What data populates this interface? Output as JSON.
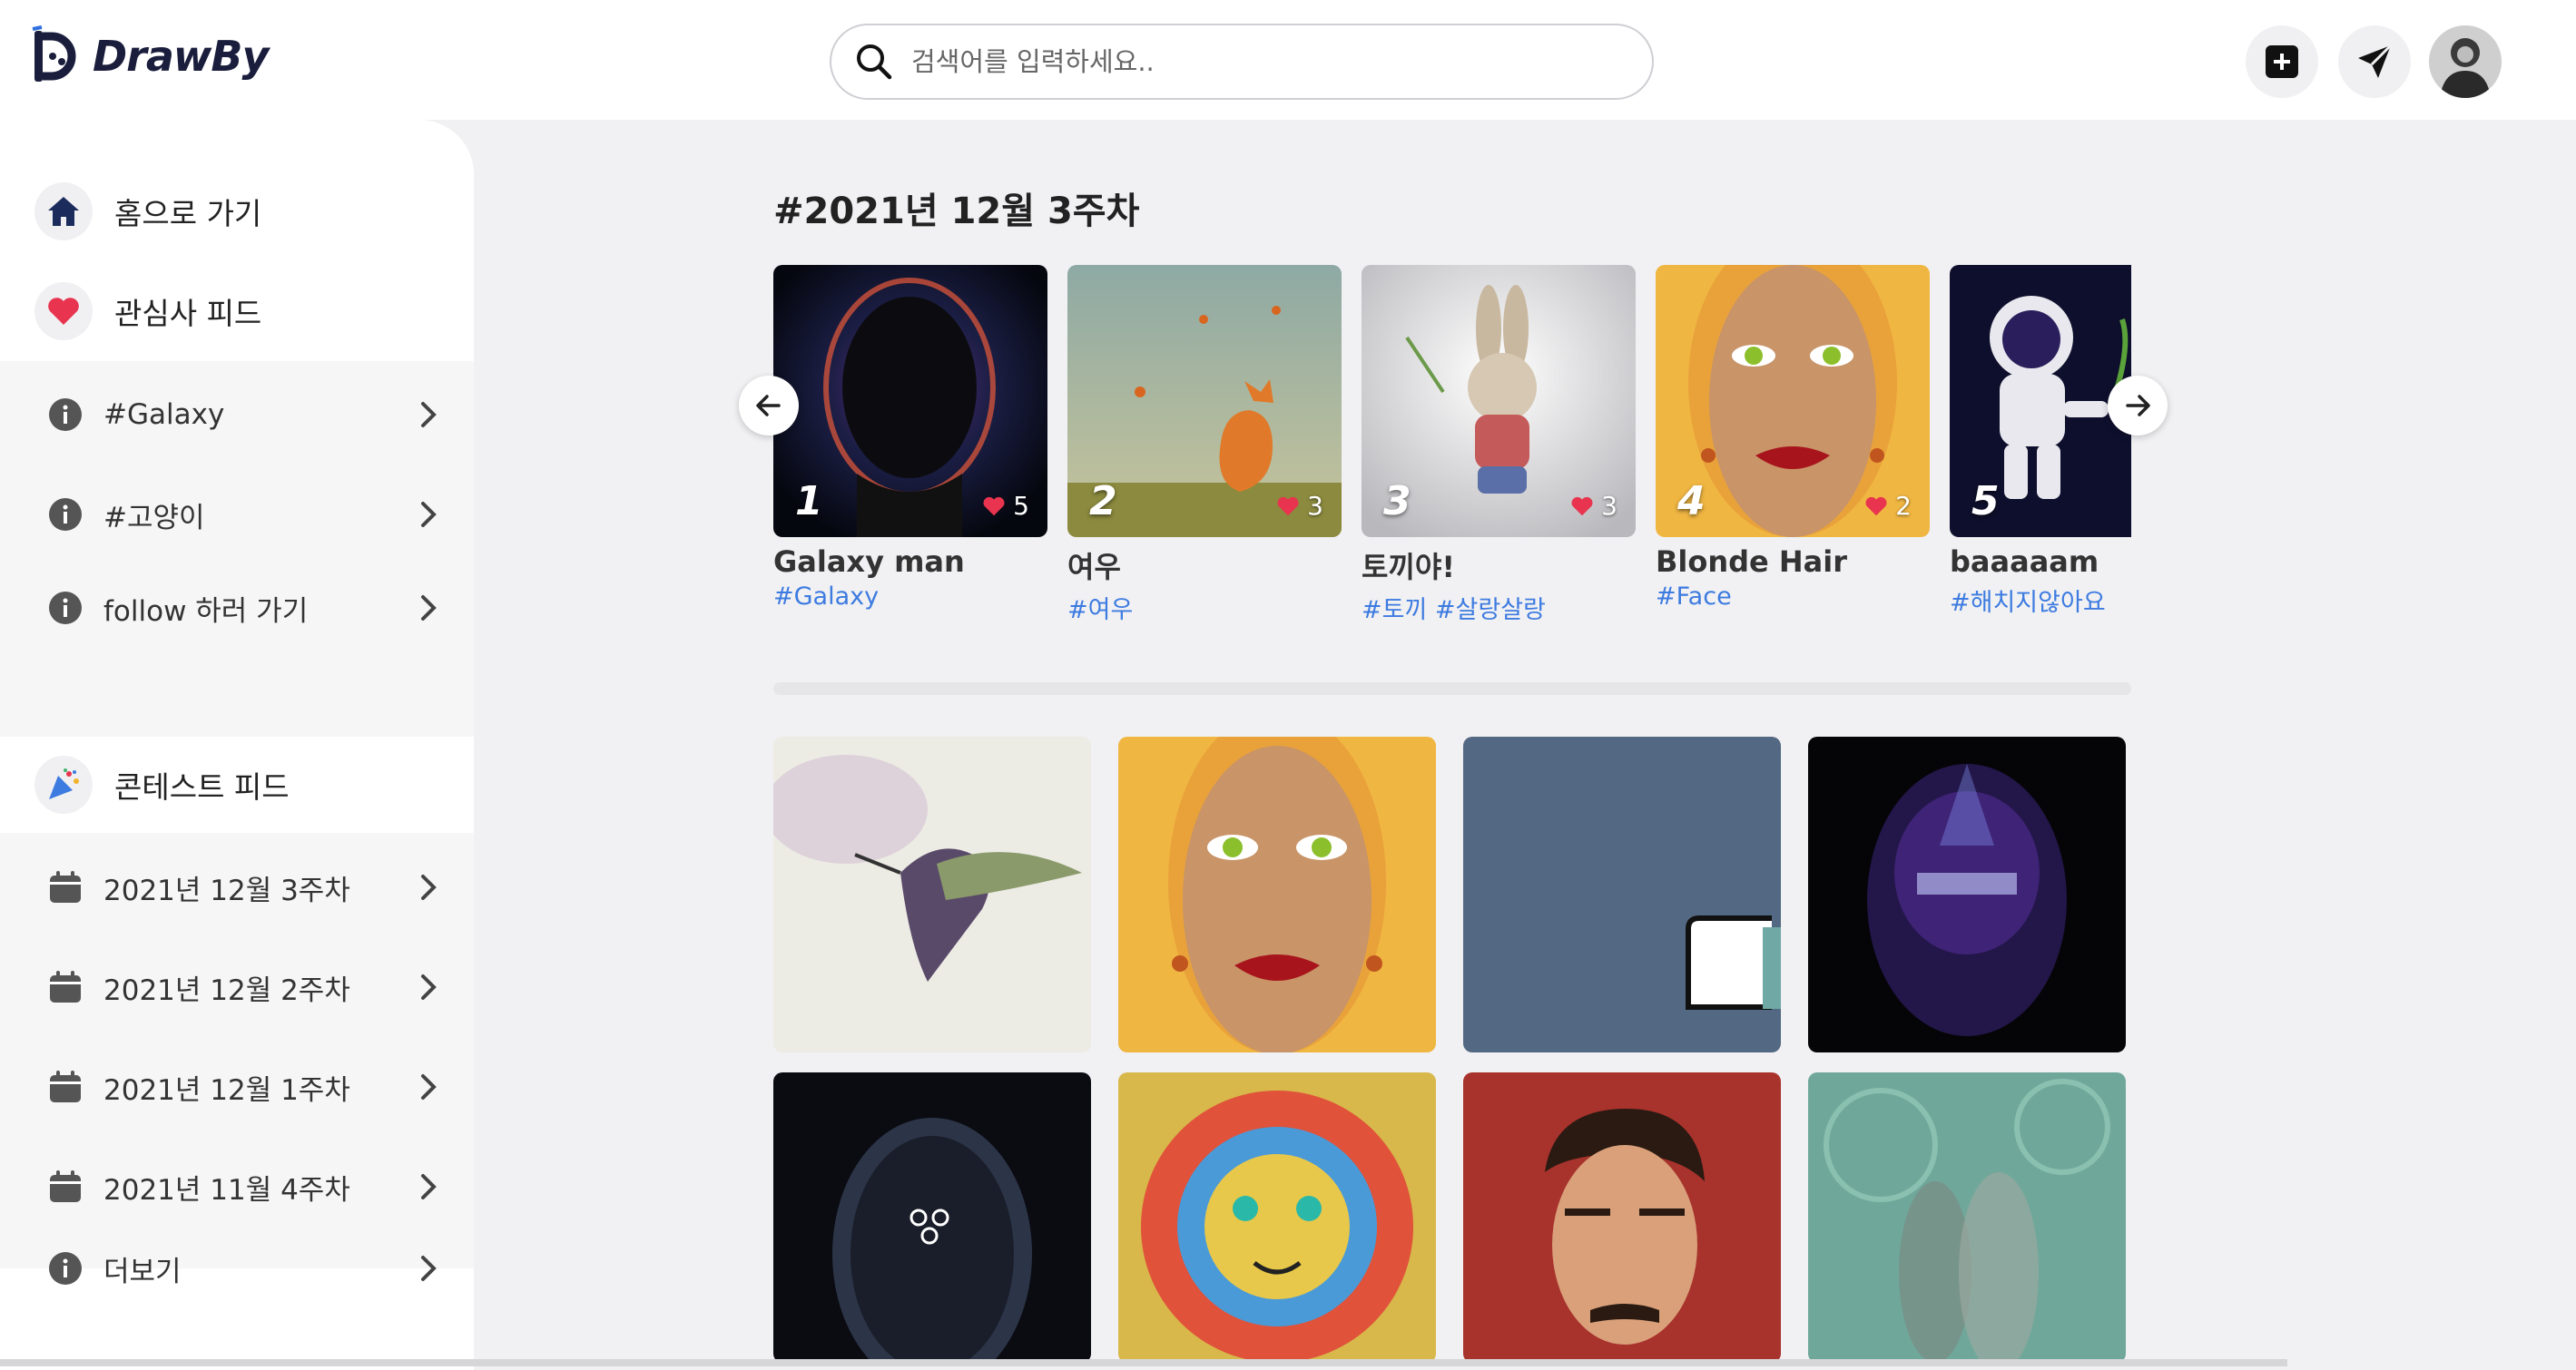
{
  "app": {
    "name": "DrawBy"
  },
  "search": {
    "placeholder": "검색어를 입력하세요.."
  },
  "header": {
    "icons": [
      "plus-square-icon",
      "send-icon",
      "avatar"
    ]
  },
  "sidebar": {
    "top_items": [
      {
        "label": "홈으로 가기",
        "icon": "home-icon"
      },
      {
        "label": "관심사 피드",
        "icon": "heart-icon"
      }
    ],
    "interest_items": [
      {
        "label": "#Galaxy",
        "icon": "info-icon"
      },
      {
        "label": "#고양이",
        "icon": "info-icon"
      },
      {
        "label": "follow 하러 가기",
        "icon": "info-icon"
      }
    ],
    "contest_header": {
      "label": "콘테스트 피드",
      "icon": "party-popper-icon"
    },
    "contest_items": [
      {
        "label": "2021년 12월 3주차",
        "icon": "calendar-icon"
      },
      {
        "label": "2021년 12월 2주차",
        "icon": "calendar-icon"
      },
      {
        "label": "2021년 12월 1주차",
        "icon": "calendar-icon"
      },
      {
        "label": "2021년 11월 4주차",
        "icon": "calendar-icon"
      },
      {
        "label": "더보기",
        "icon": "info-icon"
      }
    ]
  },
  "main": {
    "section_title": "#2021년 12월 3주차",
    "ranking": [
      {
        "rank": "1",
        "likes": "5",
        "title": "Galaxy man",
        "tags": "#Galaxy"
      },
      {
        "rank": "2",
        "likes": "3",
        "title": "여우",
        "tags": "#여우"
      },
      {
        "rank": "3",
        "likes": "3",
        "title": "토끼야!",
        "tags": "#토끼  #살랑살랑"
      },
      {
        "rank": "4",
        "likes": "2",
        "title": "Blonde Hair",
        "tags": "#Face"
      },
      {
        "rank": "5",
        "likes": "",
        "title": "baaaaam",
        "tags": "#해치지않아요"
      }
    ],
    "grid_count_visible": 8
  },
  "colors": {
    "accent": "#1a2b5c",
    "heart": "#e8344e",
    "tag": "#3d7be0",
    "bg": "#f1f1f3"
  }
}
